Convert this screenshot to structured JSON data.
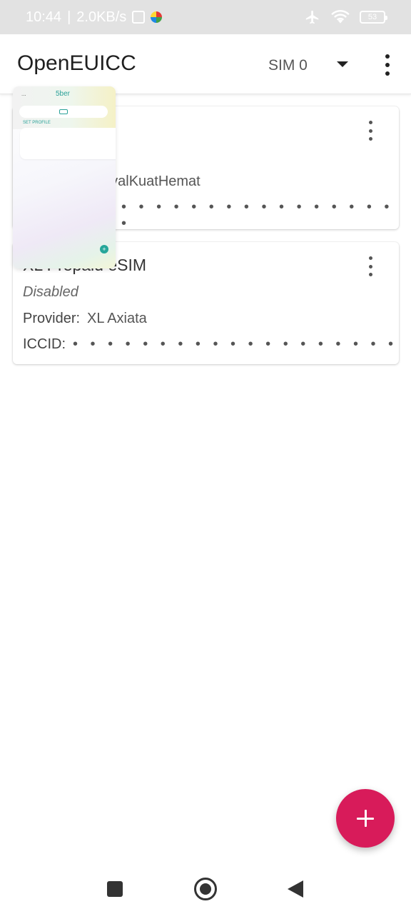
{
  "status_bar": {
    "time": "10:44",
    "network_speed": "2.0KB/s",
    "separator": "|",
    "battery_level": "53",
    "icons": [
      "nfc-icon",
      "app-notification-icon",
      "airplane-mode-icon",
      "wifi-icon",
      "battery-icon"
    ]
  },
  "app_bar": {
    "title": "OpenEUICC",
    "sim_selector": "SIM 0",
    "icons": [
      "dropdown-icon",
      "overflow-menu-icon"
    ]
  },
  "profiles": [
    {
      "name_visible": "nyalKuatHemat",
      "iccid_mask": "• • • • • • • • • • • • • • • • •"
    },
    {
      "name_visible": "eSIM",
      "name_partial": "XL Prepaid",
      "status": "Disabled",
      "provider_label": "Provider:",
      "provider_value": "XL Axiata",
      "iccid_label": "ICCID:",
      "iccid_mask": "• • • • • • • • • • • • • • • • • • •"
    }
  ],
  "recent_app_thumbnail": {
    "title": "5ber",
    "more": "...",
    "label": "SET PROFILE"
  },
  "fab": {
    "icon": "plus-icon",
    "color": "#d81b5a"
  },
  "nav_bar": {
    "icons": [
      "recents-square-icon",
      "home-circle-icon",
      "back-triangle-icon"
    ]
  }
}
